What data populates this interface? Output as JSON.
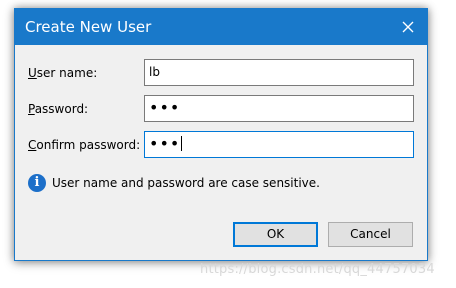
{
  "window": {
    "title": "Create New User",
    "close_icon": "close-icon"
  },
  "form": {
    "username_label_accel": "U",
    "username_label_rest": "ser name:",
    "username_value": "lb",
    "password_label_accel": "P",
    "password_label_rest": "assword:",
    "password_value": "•••",
    "confirm_label_accel": "C",
    "confirm_label_rest": "onfirm password:",
    "confirm_value": "•••"
  },
  "info": {
    "icon": "info-icon",
    "icon_glyph": "i",
    "text": "User name and password are case sensitive."
  },
  "buttons": {
    "ok_label": "OK",
    "cancel_label": "Cancel"
  },
  "watermark": {
    "text": "https://blog.csdn.net/qq_44757034"
  },
  "colors": {
    "titlebar": "#1979ca",
    "focus_border": "#0078d7",
    "info_icon": "#1c6fc9"
  }
}
